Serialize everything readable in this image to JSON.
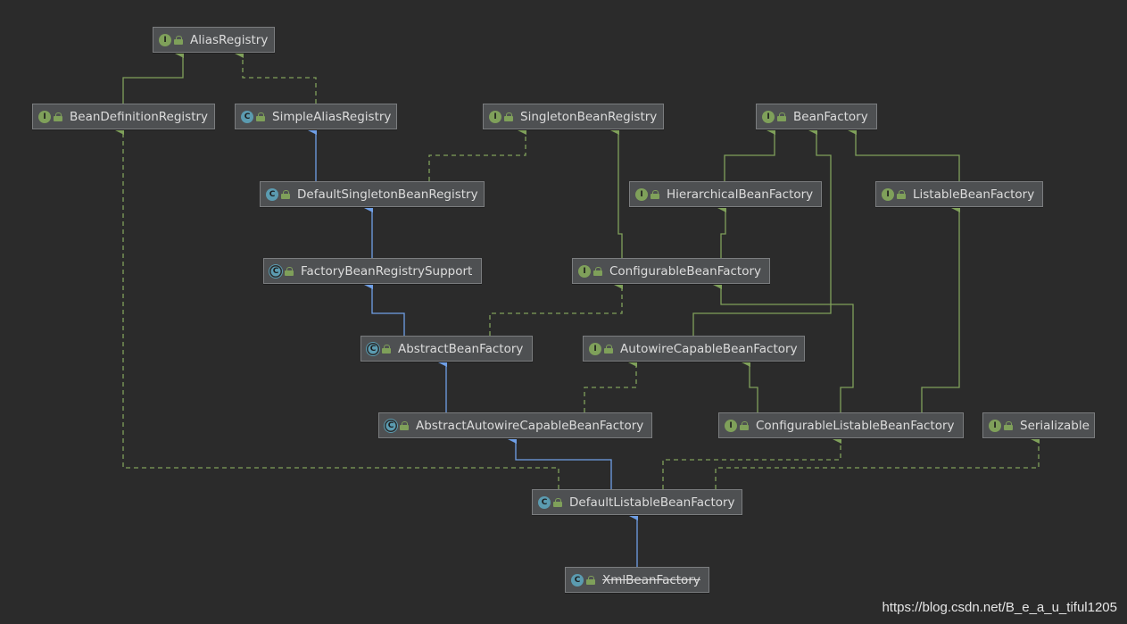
{
  "nodes": [
    {
      "id": "AliasRegistry",
      "label": "AliasRegistry",
      "kind": "interface"
    },
    {
      "id": "BeanDefinitionRegistry",
      "label": "BeanDefinitionRegistry",
      "kind": "interface"
    },
    {
      "id": "SimpleAliasRegistry",
      "label": "SimpleAliasRegistry",
      "kind": "class"
    },
    {
      "id": "SingletonBeanRegistry",
      "label": "SingletonBeanRegistry",
      "kind": "interface"
    },
    {
      "id": "BeanFactory",
      "label": "BeanFactory",
      "kind": "interface"
    },
    {
      "id": "DefaultSingletonBeanRegistry",
      "label": "DefaultSingletonBeanRegistry",
      "kind": "class"
    },
    {
      "id": "HierarchicalBeanFactory",
      "label": "HierarchicalBeanFactory",
      "kind": "interface"
    },
    {
      "id": "ListableBeanFactory",
      "label": "ListableBeanFactory",
      "kind": "interface"
    },
    {
      "id": "FactoryBeanRegistrySupport",
      "label": "FactoryBeanRegistrySupport",
      "kind": "abstract"
    },
    {
      "id": "ConfigurableBeanFactory",
      "label": "ConfigurableBeanFactory",
      "kind": "interface"
    },
    {
      "id": "AbstractBeanFactory",
      "label": "AbstractBeanFactory",
      "kind": "abstract"
    },
    {
      "id": "AutowireCapableBeanFactory",
      "label": "AutowireCapableBeanFactory",
      "kind": "interface"
    },
    {
      "id": "AbstractAutowireCapableBeanFactory",
      "label": "AbstractAutowireCapableBeanFactory",
      "kind": "abstract"
    },
    {
      "id": "ConfigurableListableBeanFactory",
      "label": "ConfigurableListableBeanFactory",
      "kind": "interface"
    },
    {
      "id": "Serializable",
      "label": "Serializable",
      "kind": "interface"
    },
    {
      "id": "DefaultListableBeanFactory",
      "label": "DefaultListableBeanFactory",
      "kind": "class"
    },
    {
      "id": "XmlBeanFactory",
      "label": "XmlBeanFactory",
      "kind": "class",
      "deprecated": true
    }
  ],
  "edges": [
    {
      "from": "BeanDefinitionRegistry",
      "to": "AliasRegistry",
      "type": "extends-interface"
    },
    {
      "from": "SimpleAliasRegistry",
      "to": "AliasRegistry",
      "type": "implements"
    },
    {
      "from": "DefaultSingletonBeanRegistry",
      "to": "SimpleAliasRegistry",
      "type": "extends-class"
    },
    {
      "from": "DefaultSingletonBeanRegistry",
      "to": "SingletonBeanRegistry",
      "type": "implements"
    },
    {
      "from": "HierarchicalBeanFactory",
      "to": "BeanFactory",
      "type": "extends-interface"
    },
    {
      "from": "ListableBeanFactory",
      "to": "BeanFactory",
      "type": "extends-interface"
    },
    {
      "from": "FactoryBeanRegistrySupport",
      "to": "DefaultSingletonBeanRegistry",
      "type": "extends-class"
    },
    {
      "from": "ConfigurableBeanFactory",
      "to": "SingletonBeanRegistry",
      "type": "extends-interface"
    },
    {
      "from": "ConfigurableBeanFactory",
      "to": "HierarchicalBeanFactory",
      "type": "extends-interface"
    },
    {
      "from": "AbstractBeanFactory",
      "to": "FactoryBeanRegistrySupport",
      "type": "extends-class"
    },
    {
      "from": "AbstractBeanFactory",
      "to": "ConfigurableBeanFactory",
      "type": "implements"
    },
    {
      "from": "AutowireCapableBeanFactory",
      "to": "BeanFactory",
      "type": "extends-interface"
    },
    {
      "from": "AbstractAutowireCapableBeanFactory",
      "to": "AbstractBeanFactory",
      "type": "extends-class"
    },
    {
      "from": "AbstractAutowireCapableBeanFactory",
      "to": "AutowireCapableBeanFactory",
      "type": "implements"
    },
    {
      "from": "ConfigurableListableBeanFactory",
      "to": "AutowireCapableBeanFactory",
      "type": "extends-interface"
    },
    {
      "from": "ConfigurableListableBeanFactory",
      "to": "ConfigurableBeanFactory",
      "type": "extends-interface"
    },
    {
      "from": "ConfigurableListableBeanFactory",
      "to": "ListableBeanFactory",
      "type": "extends-interface"
    },
    {
      "from": "DefaultListableBeanFactory",
      "to": "AbstractAutowireCapableBeanFactory",
      "type": "extends-class"
    },
    {
      "from": "DefaultListableBeanFactory",
      "to": "ConfigurableListableBeanFactory",
      "type": "implements"
    },
    {
      "from": "DefaultListableBeanFactory",
      "to": "Serializable",
      "type": "implements"
    },
    {
      "from": "DefaultListableBeanFactory",
      "to": "BeanDefinitionRegistry",
      "type": "implements"
    },
    {
      "from": "XmlBeanFactory",
      "to": "DefaultListableBeanFactory",
      "type": "extends-class"
    }
  ],
  "colors": {
    "background": "#2b2b2b",
    "node_fill": "#4e5052",
    "node_border": "#7b7d7f",
    "node_text": "#dcdcdc",
    "interface_badge": "#7fa05a",
    "class_badge": "#5b9bb0",
    "interface_edge": "#7fa05a",
    "class_edge": "#6f9fe6"
  },
  "badge_letters": {
    "interface": "I",
    "class": "C",
    "abstract": "C"
  },
  "watermark": "https://blog.csdn.net/B_e_a_u_tiful1205"
}
